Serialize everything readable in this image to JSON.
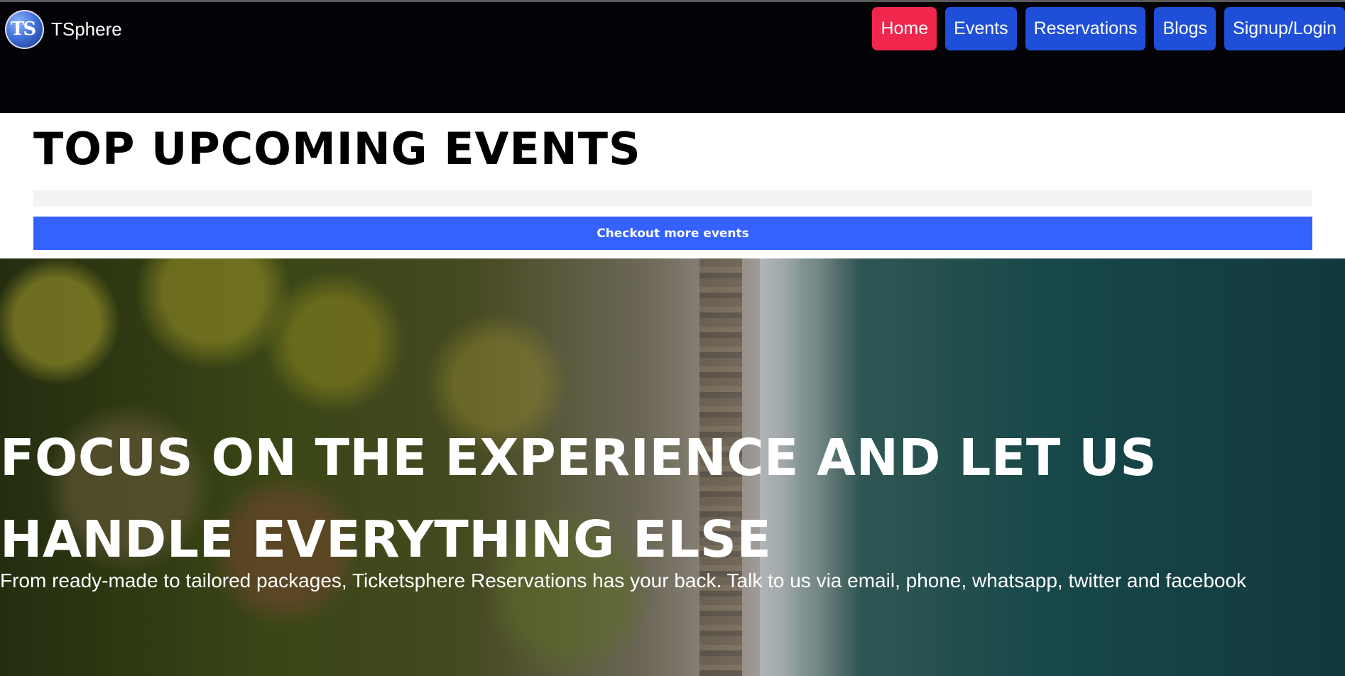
{
  "brand": {
    "name": "TSphere",
    "logo_text": "TS"
  },
  "nav": {
    "items": [
      {
        "label": "Home",
        "active": true
      },
      {
        "label": "Events",
        "active": false
      },
      {
        "label": "Reservations",
        "active": false
      },
      {
        "label": "Blogs",
        "active": false
      },
      {
        "label": "Signup/Login",
        "active": false
      }
    ],
    "active_color": "#f0264c",
    "button_color": "#1f4fd8"
  },
  "events": {
    "title": "TOP UPCOMING EVENTS",
    "more_button_label": "Checkout more events",
    "more_button_color": "#3561ff"
  },
  "hero": {
    "title": "FOCUS ON THE EXPERIENCE AND LET US HANDLE EVERYTHING ELSE",
    "subtitle": "From ready-made to tailored packages, Ticketsphere Reservations has your back. Talk to us via email, phone, whatsapp, twitter and facebook"
  }
}
